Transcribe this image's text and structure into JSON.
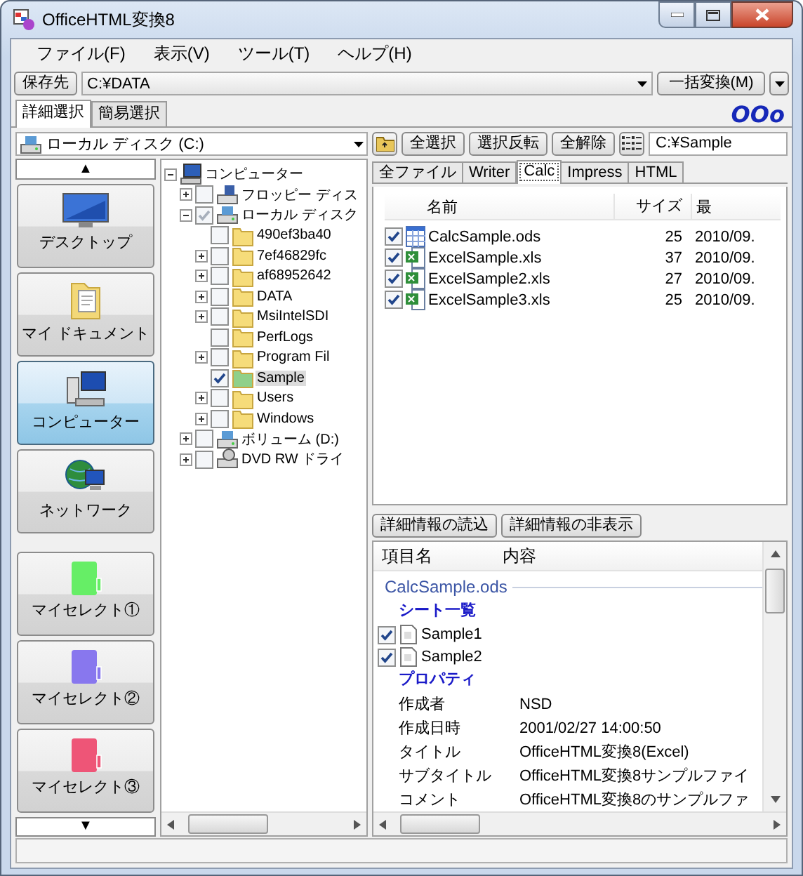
{
  "window": {
    "title": "OfficeHTML変換8"
  },
  "menu": [
    "ファイル(F)",
    "表示(V)",
    "ツール(T)",
    "ヘルプ(H)"
  ],
  "save_bar": {
    "label": "保存先",
    "path": "C:¥DATA",
    "convert_button": "一括変換(M)"
  },
  "mode_tabs": [
    {
      "label": "詳細選択",
      "selected": true
    },
    {
      "label": "簡易選択",
      "selected": false
    }
  ],
  "logo": "OOo",
  "drive": "ローカル ディスク (C:)",
  "nav": {
    "up": "▲",
    "down": "▼",
    "items": [
      {
        "label": "デスクトップ",
        "kind": "desktop",
        "selected": false
      },
      {
        "label": "マイ ドキュメント",
        "kind": "documents",
        "selected": false
      },
      {
        "label": "コンピューター",
        "kind": "computer",
        "selected": true
      },
      {
        "label": "ネットワーク",
        "kind": "network",
        "selected": false
      },
      {
        "label": "マイセレクト①",
        "kind": "myselect",
        "selected": false,
        "color": "#66ee66"
      },
      {
        "label": "マイセレクト②",
        "kind": "myselect",
        "selected": false,
        "color": "#8877ee"
      },
      {
        "label": "マイセレクト③",
        "kind": "myselect",
        "selected": false,
        "color": "#ee5577"
      }
    ]
  },
  "tree": [
    {
      "label": "コンピューター",
      "kind": "computer",
      "expandable": true,
      "expanded": true,
      "selected": false,
      "children": [
        {
          "label": "フロッピー ディス",
          "kind": "floppy",
          "checked": false,
          "expandable": true,
          "expanded": false,
          "selected": false
        },
        {
          "label": "ローカル ディスク",
          "kind": "drive",
          "checked": true,
          "mixed": true,
          "expandable": true,
          "expanded": true,
          "selected": false,
          "children": [
            {
              "label": "490ef3ba40",
              "kind": "folder",
              "checked": false,
              "expandable": false,
              "selected": false
            },
            {
              "label": "7ef46829fc",
              "kind": "folder",
              "checked": false,
              "expandable": true,
              "expanded": false,
              "selected": false
            },
            {
              "label": "af68952642",
              "kind": "folder",
              "checked": false,
              "expandable": true,
              "expanded": false,
              "selected": false
            },
            {
              "label": "DATA",
              "kind": "folder",
              "checked": false,
              "expandable": true,
              "expanded": false,
              "selected": false
            },
            {
              "label": "MsiIntelSDI",
              "kind": "folder",
              "checked": false,
              "expandable": true,
              "expanded": false,
              "selected": false
            },
            {
              "label": "PerfLogs",
              "kind": "folder",
              "checked": false,
              "expandable": false,
              "selected": false
            },
            {
              "label": "Program Fil",
              "kind": "folder",
              "checked": false,
              "expandable": true,
              "expanded": false,
              "selected": false
            },
            {
              "label": "Sample",
              "kind": "folder",
              "checked": true,
              "expandable": false,
              "selected": true
            },
            {
              "label": "Users",
              "kind": "folder",
              "checked": false,
              "expandable": true,
              "expanded": false,
              "selected": false
            },
            {
              "label": "Windows",
              "kind": "folder",
              "checked": false,
              "expandable": true,
              "expanded": false,
              "selected": false
            }
          ]
        },
        {
          "label": "ボリューム (D:)",
          "kind": "drive",
          "checked": false,
          "expandable": true,
          "expanded": false,
          "selected": false
        },
        {
          "label": "DVD RW ドライ",
          "kind": "cd",
          "checked": false,
          "expandable": true,
          "expanded": false,
          "selected": false
        }
      ]
    }
  ],
  "file_pane": {
    "buttons": [
      "全選択",
      "選択反転",
      "全解除"
    ],
    "path": "C:¥Sample",
    "tabs": [
      {
        "label": "全ファイル",
        "selected": false
      },
      {
        "label": "Writer",
        "selected": false
      },
      {
        "label": "Calc",
        "selected": true
      },
      {
        "label": "Impress",
        "selected": false
      },
      {
        "label": "HTML",
        "selected": false
      }
    ],
    "columns": [
      "名前",
      "サイズ",
      "最"
    ],
    "rows": [
      {
        "name": "CalcSample.ods",
        "kind": "ods",
        "size": "25",
        "date": "2010/09.",
        "checked": true
      },
      {
        "name": "ExcelSample.xls",
        "kind": "xls",
        "size": "37",
        "date": "2010/09.",
        "checked": true
      },
      {
        "name": "ExcelSample2.xls",
        "kind": "xls",
        "size": "27",
        "date": "2010/09.",
        "checked": true
      },
      {
        "name": "ExcelSample3.xls",
        "kind": "xls",
        "size": "25",
        "date": "2010/09.",
        "checked": true
      }
    ]
  },
  "detail": {
    "buttons": [
      "詳細情報の読込",
      "詳細情報の非表示"
    ],
    "columns": [
      "項目名",
      "内容"
    ],
    "file": "CalcSample.ods",
    "sheets_title": "シート一覧",
    "sheets": [
      {
        "name": "Sample1",
        "checked": true
      },
      {
        "name": "Sample2",
        "checked": true
      }
    ],
    "props_title": "プロパティ",
    "properties": [
      {
        "key": "作成者",
        "value": "NSD"
      },
      {
        "key": "作成日時",
        "value": "2001/02/27 14:00:50"
      },
      {
        "key": "タイトル",
        "value": "OfficeHTML変換8(Excel)"
      },
      {
        "key": "サブタイトル",
        "value": "OfficeHTML変換8サンプルファイ"
      },
      {
        "key": "コメント",
        "value": "OfficeHTML変換8のサンプルファ"
      }
    ]
  }
}
